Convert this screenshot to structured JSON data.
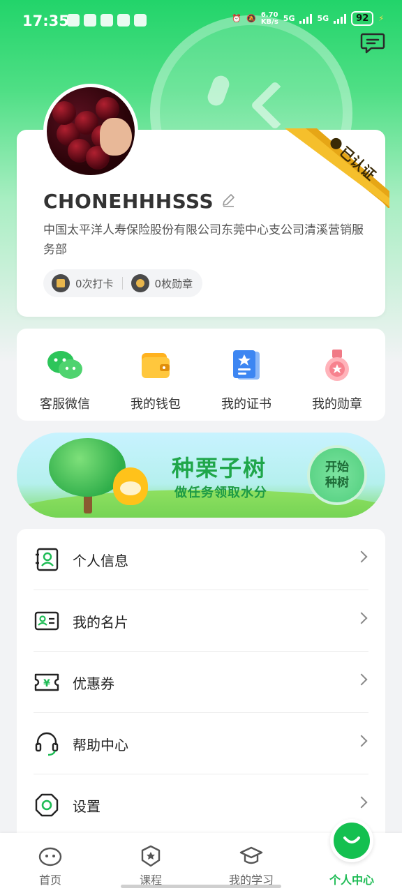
{
  "status_bar": {
    "time": "17:35",
    "net_speed_value": "6.70",
    "net_speed_unit": "KB/s",
    "sim1": "5G",
    "sim2": "5G",
    "battery": "92"
  },
  "profile": {
    "username": "CHONEHHHSSS",
    "company": "中国太平洋人寿保险股份有限公司东莞中心支公司清溪营销服务部",
    "verified_label": "已认证",
    "stats": [
      {
        "label": "0次打卡"
      },
      {
        "label": "0枚勋章"
      }
    ]
  },
  "quick_actions": [
    {
      "label": "客服微信",
      "icon": "wechat-icon"
    },
    {
      "label": "我的钱包",
      "icon": "wallet-icon"
    },
    {
      "label": "我的证书",
      "icon": "certificate-icon"
    },
    {
      "label": "我的勋章",
      "icon": "medal-icon"
    }
  ],
  "banner": {
    "title": "种栗子树",
    "subtitle": "做任务领取水分",
    "button_line1": "开始",
    "button_line2": "种树"
  },
  "menu": [
    {
      "label": "个人信息",
      "icon": "profile-info-icon"
    },
    {
      "label": "我的名片",
      "icon": "business-card-icon"
    },
    {
      "label": "优惠券",
      "icon": "coupon-icon"
    },
    {
      "label": "帮助中心",
      "icon": "headset-icon"
    },
    {
      "label": "设置",
      "icon": "settings-icon"
    }
  ],
  "tabs": [
    {
      "label": "首页",
      "icon": "home-icon",
      "active": false
    },
    {
      "label": "课程",
      "icon": "course-icon",
      "active": false
    },
    {
      "label": "我的学习",
      "icon": "study-icon",
      "active": false
    },
    {
      "label": "个人中心",
      "icon": "smile-icon",
      "active": true
    }
  ],
  "colors": {
    "brand_green": "#1dbb54",
    "verified_gold": "#f2b71f"
  }
}
